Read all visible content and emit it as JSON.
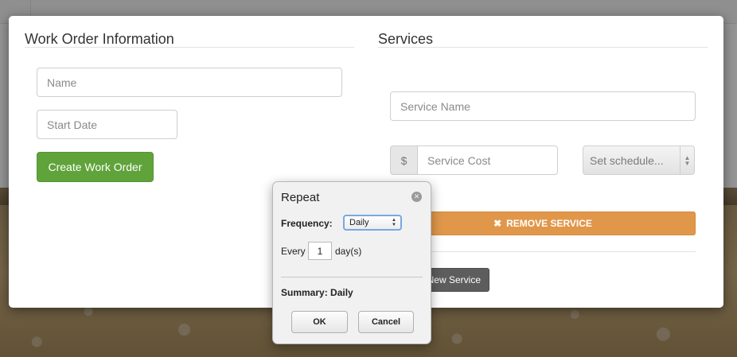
{
  "work_order": {
    "title": "Work Order Information",
    "name_placeholder": "Name",
    "start_date_placeholder": "Start Date",
    "create_button": "Create Work Order"
  },
  "services": {
    "title": "Services",
    "service_name_placeholder": "Service Name",
    "currency_addon": "$",
    "service_cost_placeholder": "Service Cost",
    "schedule_select_value": "Set schedule...",
    "remove_button_icon": "close-icon",
    "remove_button": "REMOVE SERVICE",
    "new_service_button": "New Service"
  },
  "repeat_popover": {
    "title": "Repeat",
    "close_icon": "circle-x-icon",
    "frequency_label": "Frequency:",
    "frequency_value": "Daily",
    "every_label": "Every",
    "every_value": "1",
    "every_unit": "day(s)",
    "summary": "Summary: Daily",
    "ok_button": "OK",
    "cancel_button": "Cancel"
  },
  "colors": {
    "create_button": "#5fa33a",
    "remove_button": "#e1974a",
    "new_service_button": "#5d5d5d",
    "focus_ring": "#7aa7e0"
  }
}
